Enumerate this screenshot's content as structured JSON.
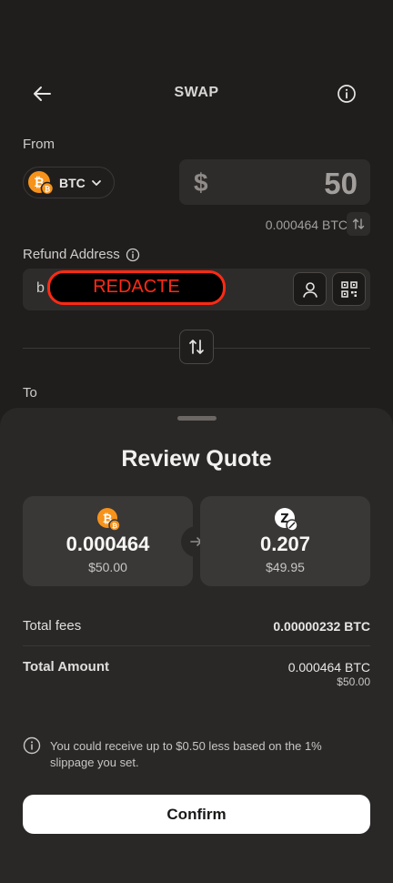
{
  "header": {
    "title": "SWAP",
    "back_icon": "arrow-left-icon",
    "info_icon": "info-icon"
  },
  "from": {
    "label": "From",
    "token": {
      "symbol": "BTC",
      "icon": "bitcoin-icon"
    },
    "currency_symbol": "$",
    "amount": "50",
    "converted": "0.000464 BTC"
  },
  "refund": {
    "label": "Refund Address",
    "prefix": "b",
    "redacted": "REDACTE"
  },
  "to": {
    "label": "To"
  },
  "quote": {
    "title": "Review Quote",
    "from_card": {
      "amount": "0.000464",
      "usd": "$50.00"
    },
    "to_card": {
      "amount": "0.207",
      "usd": "$49.95"
    },
    "fees_label": "Total fees",
    "fees_value": "0.00000232 BTC",
    "total_label": "Total Amount",
    "total_value": "0.000464 BTC",
    "total_usd": "$50.00",
    "notice": "You could receive up to $0.50 less based on the 1% slippage you set.",
    "confirm_label": "Confirm"
  },
  "colors": {
    "background": "#201e1d",
    "sheet": "#2a2827",
    "card": "#3a3837",
    "bitcoin": "#f7931a",
    "redaction": "#ff2a14"
  }
}
